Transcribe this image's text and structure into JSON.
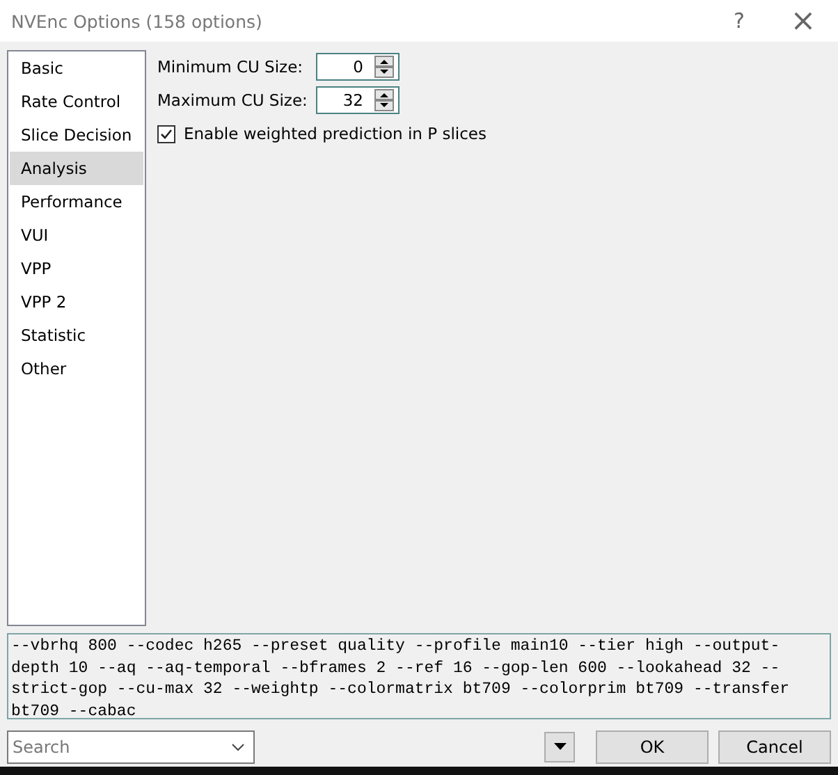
{
  "window": {
    "title": "NVEnc Options (158 options)",
    "help": "?",
    "close": "×"
  },
  "sidebar": {
    "items": [
      {
        "label": "Basic",
        "selected": false
      },
      {
        "label": "Rate Control",
        "selected": false
      },
      {
        "label": "Slice Decision",
        "selected": false
      },
      {
        "label": "Analysis",
        "selected": true
      },
      {
        "label": "Performance",
        "selected": false
      },
      {
        "label": "VUI",
        "selected": false
      },
      {
        "label": "VPP",
        "selected": false
      },
      {
        "label": "VPP 2",
        "selected": false
      },
      {
        "label": "Statistic",
        "selected": false
      },
      {
        "label": "Other",
        "selected": false
      }
    ]
  },
  "options": [
    {
      "kind": "spinner",
      "label": "Minimum CU Size:",
      "value": "0"
    },
    {
      "kind": "spinner",
      "label": "Maximum CU Size:",
      "value": "32"
    },
    {
      "kind": "checkbox",
      "label": "Enable weighted prediction in P slices",
      "checked": true
    }
  ],
  "command_line": {
    "value": "--vbrhq 800 --codec h265 --preset quality --profile main10 --tier high --output-\ndepth 10 --aq --aq-temporal --bframes 2 --ref 16 --gop-len 600 --lookahead 32 --\nstrict-gop --cu-max 32 --weightp --colormatrix bt709 --colorprim bt709 --transfer\nbt709 --cabac"
  },
  "search": {
    "placeholder": "Search"
  },
  "buttons": [
    {
      "label": "OK"
    },
    {
      "label": "Cancel"
    }
  ]
}
